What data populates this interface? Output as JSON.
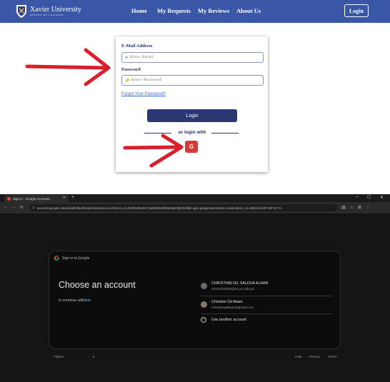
{
  "site": {
    "logo_name": "Xavier University",
    "logo_sub": "ATENEO DE CAGAYAN",
    "nav": [
      "Home",
      "My Requests",
      "My Reviews",
      "About Us"
    ],
    "login_button": "Login",
    "email_label": "E-Mail Address",
    "email_placeholder": "Enter Email",
    "password_label": "Password",
    "password_placeholder": "Enter Password",
    "forgot": "Forgot Your Password?",
    "login_submit": "Login",
    "or_text": "or login with",
    "google_button": "G"
  },
  "browser": {
    "tab_title": "Sign in - Google Accounts",
    "url": "accounts.google.com/o/oauth2/auth/oauthchooseaccount?client_id=414301651467-j48n8kn54h8b9o6dpr32j32hefj5o.apps.googleusercontent.com&redirect_uri=http%3A%2F%2F127.0..."
  },
  "google": {
    "header": "Sign in to Google",
    "title": "Choose an account",
    "subtitle_prefix": "to continue with",
    "subtitle_app": "test",
    "accounts": [
      {
        "name": "CHRISTIAN GIL SALDUA ALAAN",
        "email": "20210023842@my.xu.edu.ph"
      },
      {
        "name": "Christian Gil Alaan",
        "email": "christiangilalaan@gmail.com"
      }
    ],
    "use_another": "Use another account",
    "footer_lang": "Filipino",
    "footer_links": [
      "Help",
      "Privacy",
      "Terms"
    ]
  },
  "colors": {
    "nav_bg": "#3a57a7",
    "brand_dark": "#2a3770",
    "google_button": "#d33b3b",
    "arrow": "#d8202a",
    "dark_bg": "#141414"
  }
}
